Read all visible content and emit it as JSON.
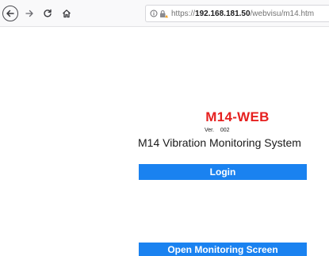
{
  "browser": {
    "url_prefix": "https://",
    "url_host": "192.168.181.50",
    "url_path": "/webvisu/m14.htm"
  },
  "app": {
    "title": "M14-WEB",
    "version": "Ver.    002",
    "system_name": "M14 Vibration Monitoring System",
    "login_label": "Login",
    "monitor_label": "Open Monitoring Screen"
  },
  "colors": {
    "title_red": "#e6201f",
    "button_blue": "#1a82f0"
  },
  "icons": {
    "back": "back-icon",
    "forward": "forward-icon",
    "reload": "reload-icon",
    "home": "home-icon",
    "info": "info-icon",
    "lock": "lock-warning-icon"
  }
}
